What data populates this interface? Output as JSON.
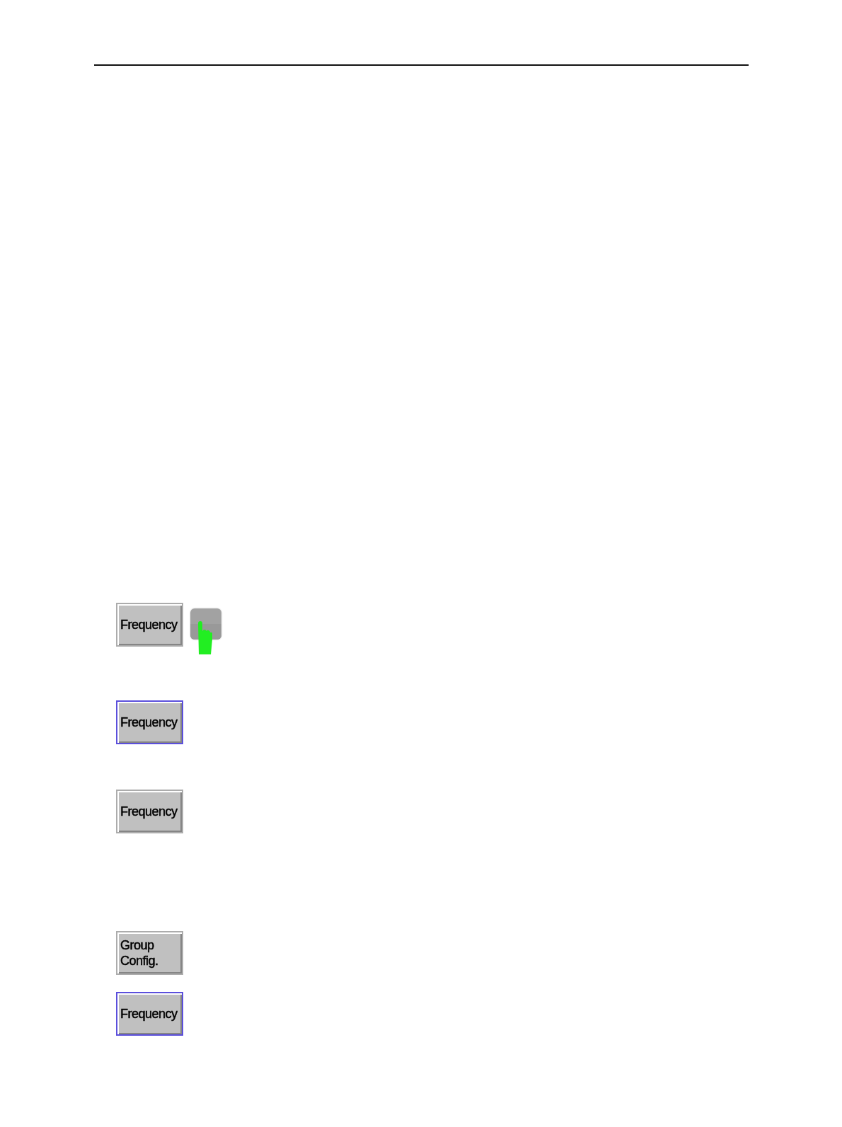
{
  "buttons": [
    {
      "label": "Frequency",
      "focused": false,
      "tap_indicator": true
    },
    {
      "label": "Frequency",
      "focused": true,
      "tap_indicator": false
    },
    {
      "label": "Frequency",
      "focused": false,
      "tap_indicator": false
    },
    {
      "label": "Group Config.",
      "focused": false,
      "tap_indicator": false
    },
    {
      "label": "Frequency",
      "focused": true,
      "tap_indicator": false
    }
  ]
}
